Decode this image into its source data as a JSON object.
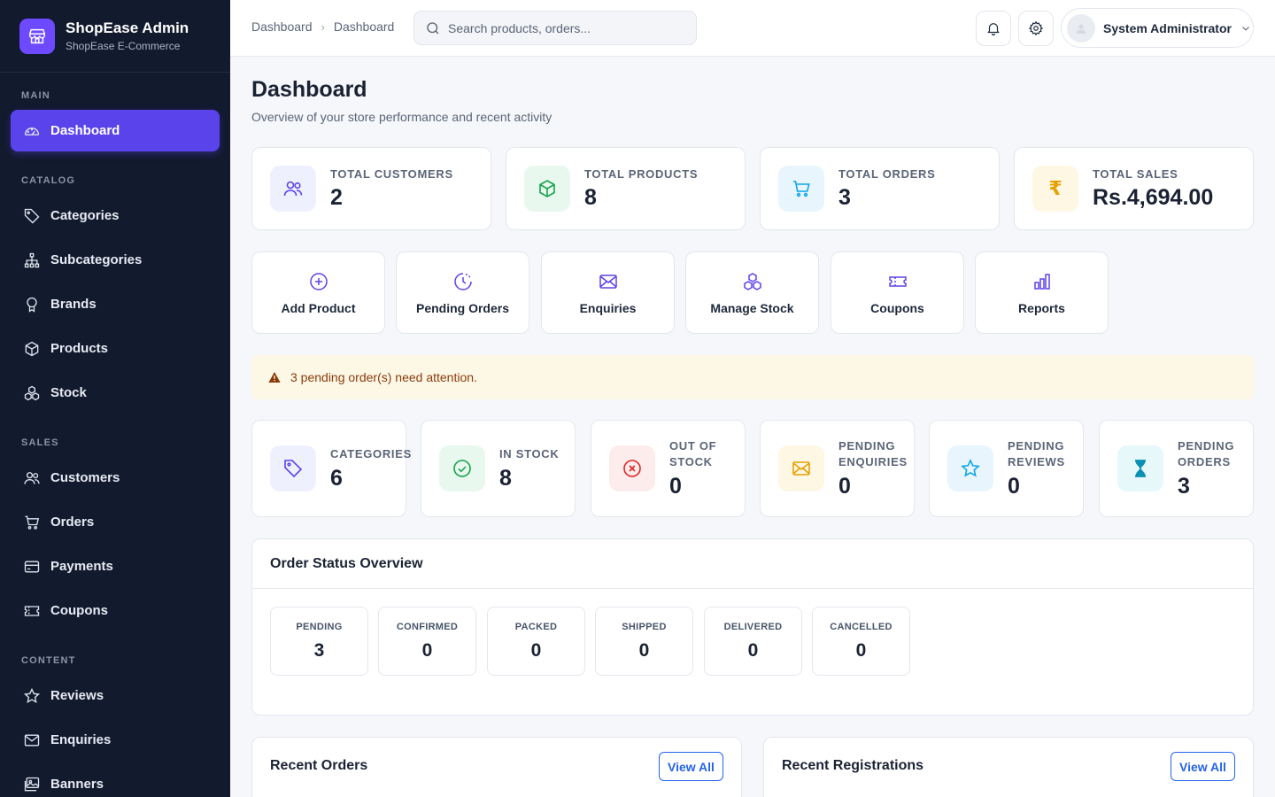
{
  "brand": {
    "title": "ShopEase Admin",
    "subtitle": "ShopEase E-Commerce"
  },
  "sidebar": {
    "sections": [
      {
        "label": "MAIN",
        "items": [
          {
            "label": "Dashboard",
            "icon": "gauge-icon",
            "active": true
          }
        ]
      },
      {
        "label": "CATALOG",
        "items": [
          {
            "label": "Categories",
            "icon": "tag-icon"
          },
          {
            "label": "Subcategories",
            "icon": "sitemap-icon"
          },
          {
            "label": "Brands",
            "icon": "award-icon"
          },
          {
            "label": "Products",
            "icon": "box-icon"
          },
          {
            "label": "Stock",
            "icon": "boxes-icon"
          }
        ]
      },
      {
        "label": "SALES",
        "items": [
          {
            "label": "Customers",
            "icon": "users-icon"
          },
          {
            "label": "Orders",
            "icon": "cart-icon"
          },
          {
            "label": "Payments",
            "icon": "credit-card-icon"
          },
          {
            "label": "Coupons",
            "icon": "ticket-icon"
          }
        ]
      },
      {
        "label": "CONTENT",
        "items": [
          {
            "label": "Reviews",
            "icon": "star-icon"
          },
          {
            "label": "Enquiries",
            "icon": "envelope-icon"
          },
          {
            "label": "Banners",
            "icon": "images-icon"
          }
        ]
      }
    ]
  },
  "topbar": {
    "breadcrumb": [
      "Dashboard",
      "Dashboard"
    ],
    "search_placeholder": "Search products, orders...",
    "user_name": "System Administrator"
  },
  "page": {
    "title": "Dashboard",
    "subtitle": "Overview of your store performance and recent activity"
  },
  "stats": [
    {
      "label": "TOTAL CUSTOMERS",
      "value": "2",
      "icon": "users-icon",
      "color": "#5b43ec",
      "bg": "#eef0fd"
    },
    {
      "label": "TOTAL PRODUCTS",
      "value": "8",
      "icon": "box-icon",
      "color": "#16a34a",
      "bg": "#e8f8ef"
    },
    {
      "label": "TOTAL ORDERS",
      "value": "3",
      "icon": "cart-icon",
      "color": "#0ea5e9",
      "bg": "#e8f5fd"
    },
    {
      "label": "TOTAL SALES",
      "value": "Rs.4,694.00",
      "icon": "rupee-icon",
      "color": "#e6a100",
      "bg": "#fdf7e4"
    }
  ],
  "quick_actions": [
    {
      "label": "Add Product",
      "icon": "plus-circle-icon"
    },
    {
      "label": "Pending Orders",
      "icon": "clock-icon"
    },
    {
      "label": "Enquiries",
      "icon": "envelope-icon"
    },
    {
      "label": "Manage Stock",
      "icon": "boxes-icon"
    },
    {
      "label": "Coupons",
      "icon": "ticket-icon"
    },
    {
      "label": "Reports",
      "icon": "bar-chart-icon"
    }
  ],
  "alert": {
    "text": "3 pending order(s) need attention.",
    "color": "#8a3a0a"
  },
  "mini_stats": [
    {
      "label": "CATEGORIES",
      "value": "6",
      "icon": "tag-icon",
      "color": "#5b43ec",
      "bg": "#eef0fd"
    },
    {
      "label": "IN STOCK",
      "value": "8",
      "icon": "check-circle-icon",
      "color": "#16a34a",
      "bg": "#e8f8ef"
    },
    {
      "label": "OUT OF STOCK",
      "value": "0",
      "icon": "x-circle-icon",
      "color": "#dc2626",
      "bg": "#fdecec"
    },
    {
      "label": "PENDING ENQUIRIES",
      "value": "0",
      "icon": "envelope-icon",
      "color": "#e6a100",
      "bg": "#fdf7e4"
    },
    {
      "label": "PENDING REVIEWS",
      "value": "0",
      "icon": "star-icon",
      "color": "#0ea5e9",
      "bg": "#e8f5fd"
    },
    {
      "label": "PENDING ORDERS",
      "value": "3",
      "icon": "hourglass-icon",
      "color": "#0891b2",
      "bg": "#e6f8fa"
    }
  ],
  "order_status": {
    "title": "Order Status Overview",
    "items": [
      {
        "label": "PENDING",
        "value": "3"
      },
      {
        "label": "CONFIRMED",
        "value": "0"
      },
      {
        "label": "PACKED",
        "value": "0"
      },
      {
        "label": "SHIPPED",
        "value": "0"
      },
      {
        "label": "DELIVERED",
        "value": "0"
      },
      {
        "label": "CANCELLED",
        "value": "0"
      }
    ]
  },
  "recent_orders": {
    "title": "Recent Orders",
    "button": "View All"
  },
  "recent_registrations": {
    "title": "Recent Registrations",
    "button": "View All"
  }
}
